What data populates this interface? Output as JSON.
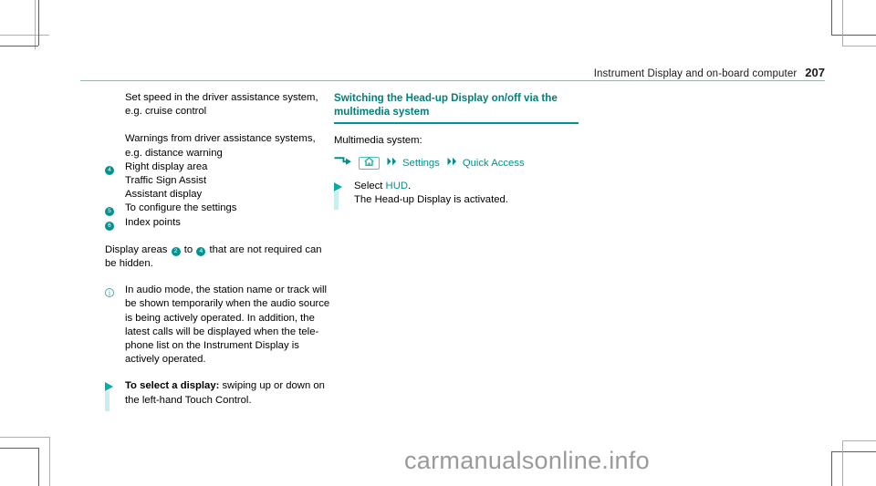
{
  "header": {
    "running_head": "Instrument Display and on-board computer",
    "page_number": "207"
  },
  "colors": {
    "teal": "#00918e",
    "teal_dark": "#00807d",
    "teal_light": "#c9eeed",
    "disc": "#00938f"
  },
  "left_column": {
    "legend_entries": [
      {
        "marker": "",
        "lines": [
          "Set speed in the driver assistance system,",
          "e.g. cruise control"
        ]
      },
      {
        "marker": "",
        "lines": [
          "Warnings from driver assistance systems,",
          "e.g. distance warning"
        ]
      },
      {
        "marker": "4",
        "lines": [
          "Right display area",
          "Traffic Sign Assist",
          "Assistant display"
        ]
      },
      {
        "marker": "5",
        "lines": [
          "To configure the settings"
        ]
      },
      {
        "marker": "6",
        "lines": [
          "Index points"
        ]
      }
    ],
    "hide_note": {
      "prefix": "Display areas",
      "from_marker": "2",
      "middle": "to",
      "to_marker": "4",
      "suffix": "that are not required can",
      "line2": "be hidden."
    },
    "info_note": "In audio mode, the station name or track will be shown temporarily when the audio source is being actively operated. In addition, the latest calls will be displayed when the tele-phone list on the Instrument Display is actively operated.",
    "info_note_lines": [
      "In audio mode, the station name or track will",
      "be shown temporarily when the audio source",
      "is being actively operated. In addition, the",
      "latest calls will be displayed when the tele-",
      "phone list on the Instrument Display is",
      "actively operated."
    ],
    "action": {
      "bold_lead": "To select a display:",
      "rest": " swiping up or down on",
      "line2": "the left-hand Touch Control."
    }
  },
  "right_column": {
    "heading_line1": "Switching the Head-up Display on/off via the",
    "heading_line2": "multimedia system",
    "intro": "Multimedia system:",
    "path": {
      "enter_icon": "enter-arrow-icon",
      "home_icon": "home-icon",
      "steps": [
        "Settings",
        "Quick Access"
      ],
      "chevron_icon": "double-chevron-right-icon"
    },
    "action": {
      "lead": "Select ",
      "highlight": "HUD",
      "period": ".",
      "line2": "The Head-up Display is activated."
    }
  },
  "watermark": {
    "text": "carmanualsonline.info"
  }
}
